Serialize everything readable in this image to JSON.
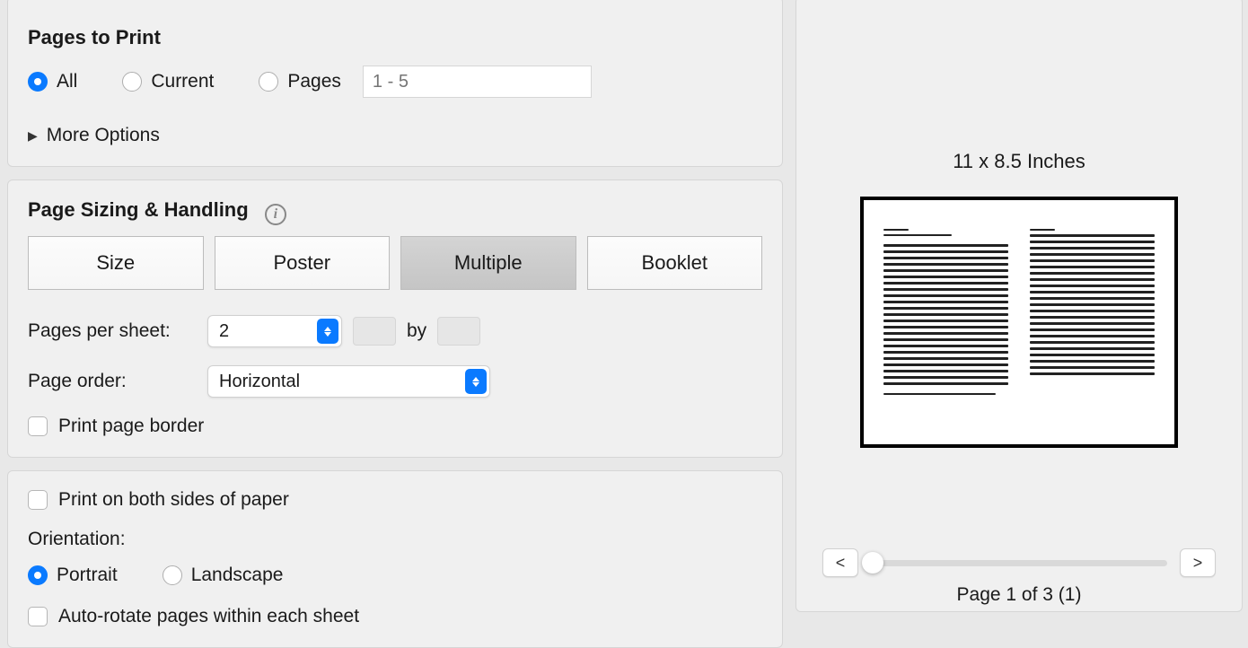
{
  "pagesToPrint": {
    "title": "Pages to Print",
    "all": "All",
    "current": "Current",
    "pages": "Pages",
    "rangePlaceholder": "1 - 5",
    "moreOptions": "More Options"
  },
  "sizing": {
    "title": "Page Sizing & Handling",
    "size": "Size",
    "poster": "Poster",
    "multiple": "Multiple",
    "booklet": "Booklet",
    "pagesPerSheetLabel": "Pages per sheet:",
    "pagesPerSheetValue": "2",
    "by": "by",
    "pageOrderLabel": "Page order:",
    "pageOrderValue": "Horizontal",
    "printBorder": "Print page border"
  },
  "duplex": {
    "bothSides": "Print on both sides of paper",
    "orientation": "Orientation:",
    "portrait": "Portrait",
    "landscape": "Landscape",
    "autoRotate": "Auto-rotate pages within each sheet"
  },
  "preview": {
    "paperSize": "11 x 8.5 Inches",
    "prev": "<",
    "next": ">",
    "pageLabel": "Page 1 of 3 (1)"
  }
}
